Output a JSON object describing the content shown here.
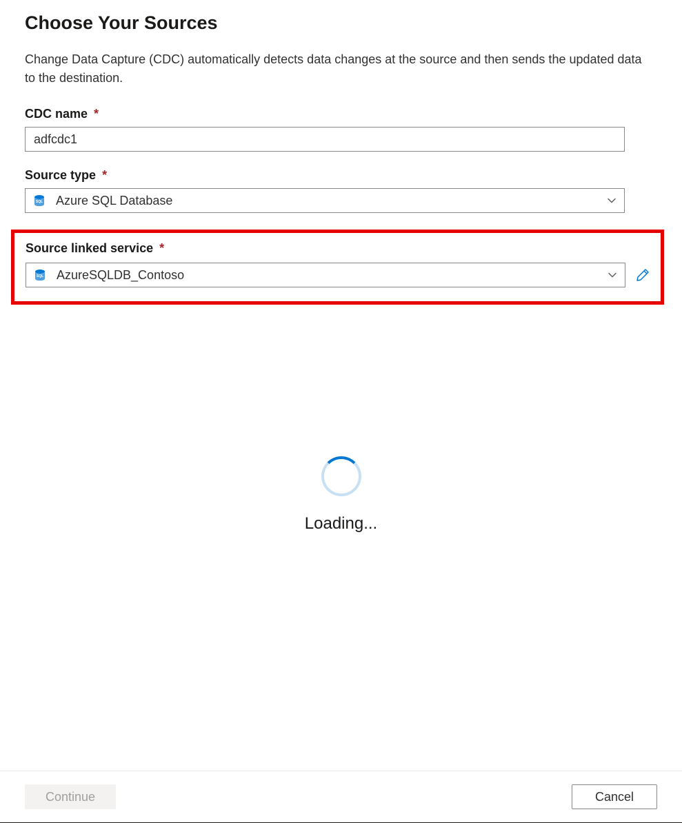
{
  "header": {
    "title": "Choose Your Sources",
    "description": "Change Data Capture (CDC) automatically detects data changes at the source and then sends the updated data to the destination."
  },
  "form": {
    "cdc_name": {
      "label": "CDC name",
      "required_marker": "*",
      "value": "adfcdc1"
    },
    "source_type": {
      "label": "Source type",
      "required_marker": "*",
      "value": "Azure SQL Database",
      "icon_name": "azure-sql-icon"
    },
    "source_linked_service": {
      "label": "Source linked service",
      "required_marker": "*",
      "value": "AzureSQLDB_Contoso",
      "icon_name": "azure-sql-icon"
    }
  },
  "loading": {
    "text": "Loading..."
  },
  "footer": {
    "continue_label": "Continue",
    "cancel_label": "Cancel"
  },
  "colors": {
    "highlight_border": "#e60000",
    "required": "#a4262c",
    "spinner_accent": "#0078d4"
  }
}
